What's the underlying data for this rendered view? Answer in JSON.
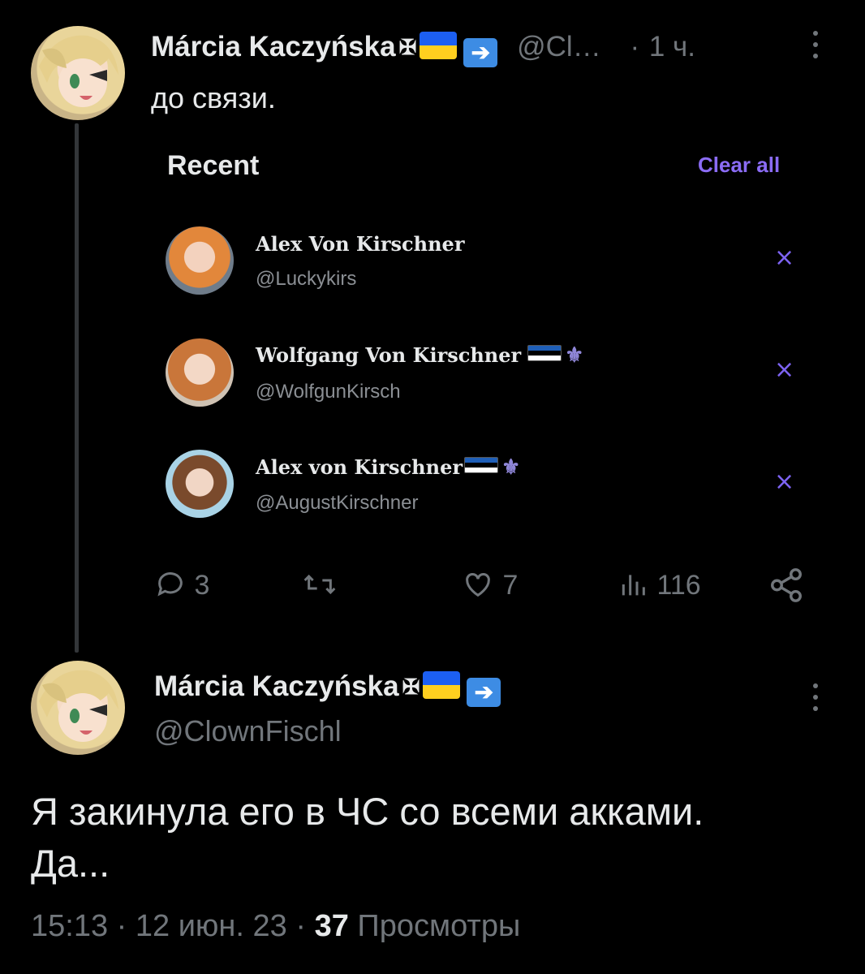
{
  "post1": {
    "author_name": "Márcia Kaczyńska",
    "author_symbol": "✠",
    "handle_short": "@Cl…",
    "time_sep": "·",
    "time": "1 ч.",
    "text": "до связи."
  },
  "recent_panel": {
    "title": "Recent",
    "clear_all": "Clear all",
    "items": [
      {
        "name": "Alex Von Kirschner",
        "handle": "@Luckykirs",
        "remove": "×"
      },
      {
        "name": "Wolfgang Von Kirschner",
        "handle": "@WolfgunKirsch",
        "remove": "×",
        "fleur": "⚜"
      },
      {
        "name": "Alex von Kirschner",
        "handle": "@AugustKirschner",
        "remove": "×",
        "fleur": "⚜"
      }
    ]
  },
  "actions": {
    "replies": "3",
    "likes": "7",
    "views": "116"
  },
  "post2": {
    "author_name": "Márcia Kaczyńska",
    "author_symbol": "✠",
    "handle": "@ClownFischl",
    "text_line1": "Я закинула его в ЧС со всеми акками.",
    "text_line2": "Да...",
    "time": "15:13",
    "sep1": "·",
    "date": "12 июн. 23",
    "sep2": "·",
    "views_count": "37",
    "views_label": "Просмотры"
  },
  "colors": {
    "background": "#000000",
    "text": "#e7e9ea",
    "muted": "#71767b",
    "accent_purple": "#8b6cf5"
  }
}
